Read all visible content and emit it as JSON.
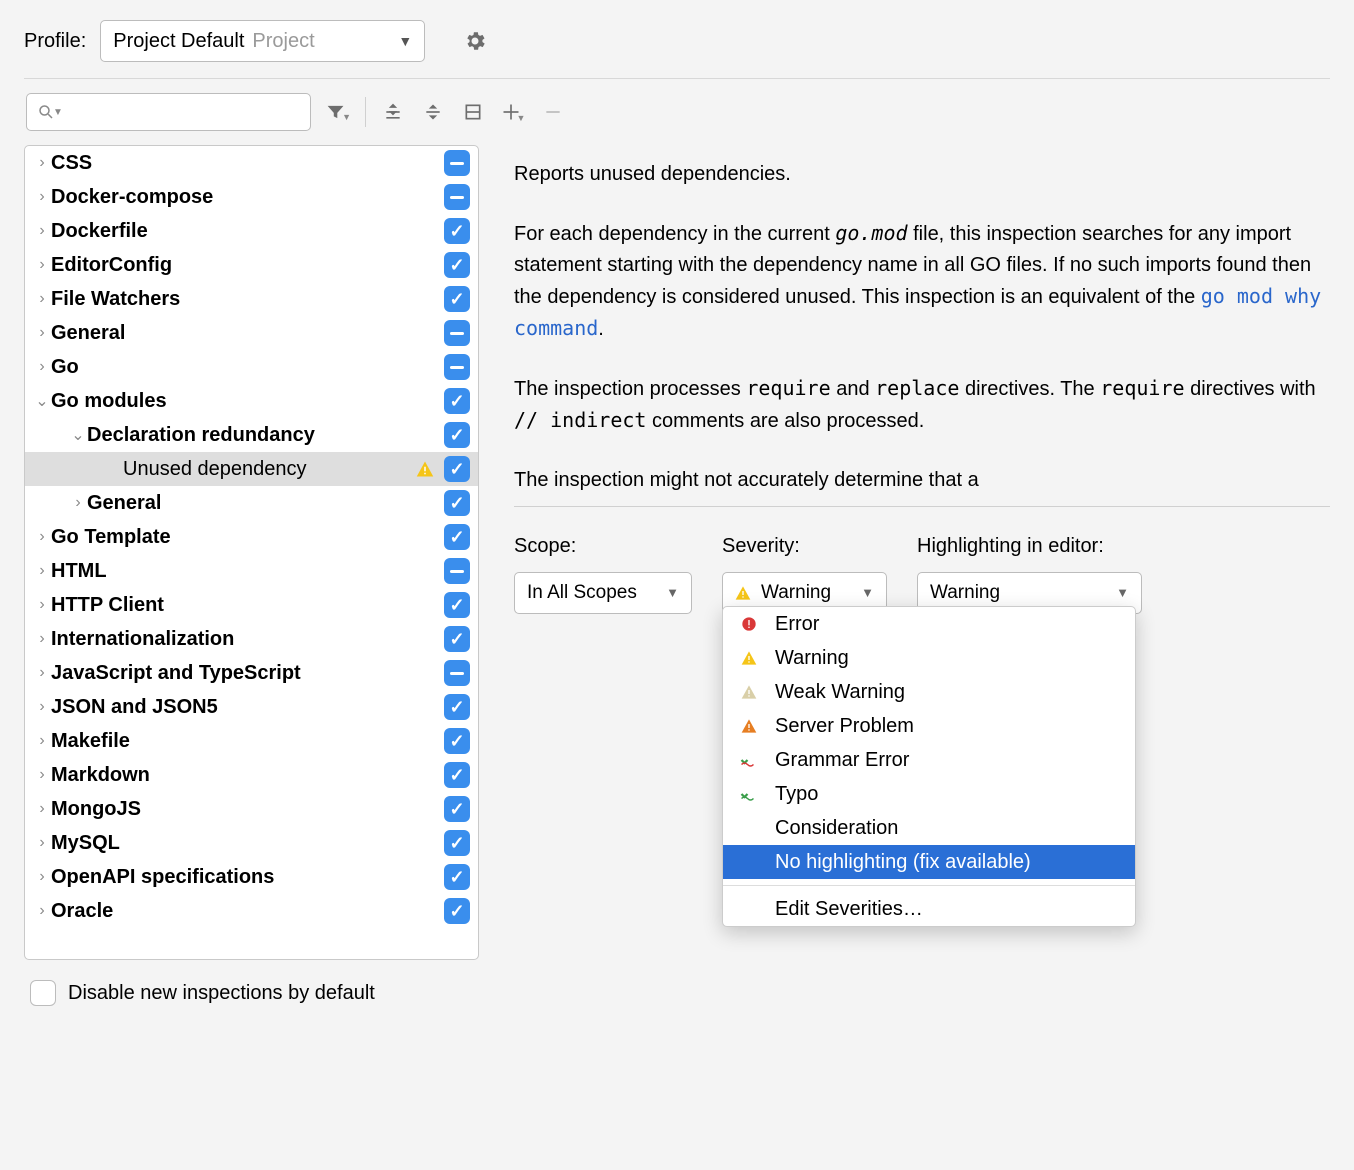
{
  "header": {
    "profile_label": "Profile:",
    "profile_value": "Project Default",
    "profile_sub": "Project"
  },
  "search": {
    "placeholder": ""
  },
  "tree": [
    {
      "label": "CSS",
      "level": 0,
      "exp": false,
      "kind": "group",
      "cb": "dash"
    },
    {
      "label": "Docker-compose",
      "level": 0,
      "exp": false,
      "kind": "group",
      "cb": "dash"
    },
    {
      "label": "Dockerfile",
      "level": 0,
      "exp": false,
      "kind": "group",
      "cb": "tick"
    },
    {
      "label": "EditorConfig",
      "level": 0,
      "exp": false,
      "kind": "group",
      "cb": "tick"
    },
    {
      "label": "File Watchers",
      "level": 0,
      "exp": false,
      "kind": "group",
      "cb": "tick"
    },
    {
      "label": "General",
      "level": 0,
      "exp": false,
      "kind": "group",
      "cb": "dash"
    },
    {
      "label": "Go",
      "level": 0,
      "exp": false,
      "kind": "group",
      "cb": "dash"
    },
    {
      "label": "Go modules",
      "level": 0,
      "exp": true,
      "kind": "group",
      "cb": "tick"
    },
    {
      "label": "Declaration redundancy",
      "level": 1,
      "exp": true,
      "kind": "group",
      "cb": "tick"
    },
    {
      "label": "Unused dependency",
      "level": 2,
      "kind": "leaf",
      "cb": "tick",
      "selected": true,
      "warn": true
    },
    {
      "label": "General",
      "level": 1,
      "exp": false,
      "kind": "group",
      "cb": "tick"
    },
    {
      "label": "Go Template",
      "level": 0,
      "exp": false,
      "kind": "group",
      "cb": "tick"
    },
    {
      "label": "HTML",
      "level": 0,
      "exp": false,
      "kind": "group",
      "cb": "dash"
    },
    {
      "label": "HTTP Client",
      "level": 0,
      "exp": false,
      "kind": "group",
      "cb": "tick"
    },
    {
      "label": "Internationalization",
      "level": 0,
      "exp": false,
      "kind": "group",
      "cb": "tick"
    },
    {
      "label": "JavaScript and TypeScript",
      "level": 0,
      "exp": false,
      "kind": "group",
      "cb": "dash"
    },
    {
      "label": "JSON and JSON5",
      "level": 0,
      "exp": false,
      "kind": "group",
      "cb": "tick"
    },
    {
      "label": "Makefile",
      "level": 0,
      "exp": false,
      "kind": "group",
      "cb": "tick"
    },
    {
      "label": "Markdown",
      "level": 0,
      "exp": false,
      "kind": "group",
      "cb": "tick"
    },
    {
      "label": "MongoJS",
      "level": 0,
      "exp": false,
      "kind": "group",
      "cb": "tick"
    },
    {
      "label": "MySQL",
      "level": 0,
      "exp": false,
      "kind": "group",
      "cb": "tick"
    },
    {
      "label": "OpenAPI specifications",
      "level": 0,
      "exp": false,
      "kind": "group",
      "cb": "tick"
    },
    {
      "label": "Oracle",
      "level": 0,
      "exp": false,
      "kind": "group",
      "cb": "tick"
    }
  ],
  "disable_label": "Disable new inspections by default",
  "description": {
    "p1": "Reports unused dependencies.",
    "p2_a": "For each dependency in the current ",
    "p2_mono": "go.mod",
    "p2_b": " file, this inspection searches for any import statement starting with the dependency name in all GO files. If no such imports found then the dependency is considered unused. This inspection is an equivalent of the ",
    "p2_link": "go mod why command",
    "p2_c": ".",
    "p3_a": "The inspection processes ",
    "p3_m1": "require",
    "p3_b": " and ",
    "p3_m2": "replace",
    "p3_c": " directives. The ",
    "p3_m3": "require",
    "p3_d": " directives with ",
    "p3_m4": "// indirect",
    "p3_e": " comments are also processed.",
    "p4": "The inspection might not accurately determine that a"
  },
  "controls": {
    "scope_label": "Scope:",
    "scope_value": "In All Scopes",
    "severity_label": "Severity:",
    "severity_value": "Warning",
    "highlight_label": "Highlighting in editor:",
    "highlight_value": "Warning"
  },
  "dropdown": {
    "items": [
      {
        "label": "Error",
        "icon": "error"
      },
      {
        "label": "Warning",
        "icon": "warning"
      },
      {
        "label": "Weak Warning",
        "icon": "weak"
      },
      {
        "label": "Server Problem",
        "icon": "server"
      },
      {
        "label": "Grammar Error",
        "icon": "grammar"
      },
      {
        "label": "Typo",
        "icon": "typo"
      },
      {
        "label": "Consideration",
        "icon": ""
      },
      {
        "label": "No highlighting (fix available)",
        "icon": "",
        "selected": true
      }
    ],
    "edit": "Edit Severities…"
  }
}
